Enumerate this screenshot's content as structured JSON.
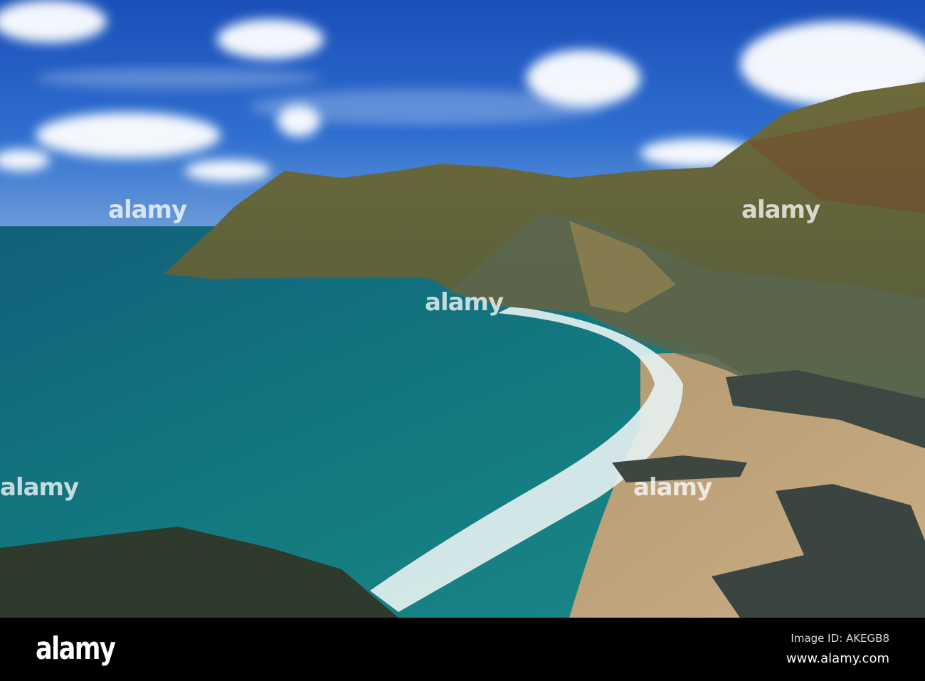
{
  "photo": {
    "subject": "coastal cove with cliffs and sandy beach"
  },
  "watermark": {
    "text": "alamy"
  },
  "footer": {
    "logo": "alamy",
    "image_id": "Image ID: AKEGB8",
    "url": "www.alamy.com"
  }
}
